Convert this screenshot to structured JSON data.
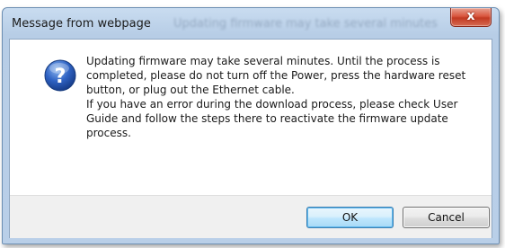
{
  "window": {
    "title": "Message from webpage",
    "background_title": "Updating firmware may take several minutes",
    "close_label": "x"
  },
  "dialog": {
    "icon": "question-icon",
    "message_lines": [
      "Updating firmware may take several minutes. Until the process is",
      "completed, please do not turn off the Power, press the hardware reset",
      "button, or plug out the Ethernet cable.",
      "If you have an error during the download process, please check User",
      "Guide and follow the steps there to reactivate the firmware update",
      "process."
    ]
  },
  "buttons": {
    "ok_label": "OK",
    "cancel_label": "Cancel"
  },
  "colors": {
    "titlebar": "#b9cfe8",
    "close_button": "#c9452d",
    "icon_blue": "#2a5db8",
    "ok_border": "#3c7fb1"
  }
}
